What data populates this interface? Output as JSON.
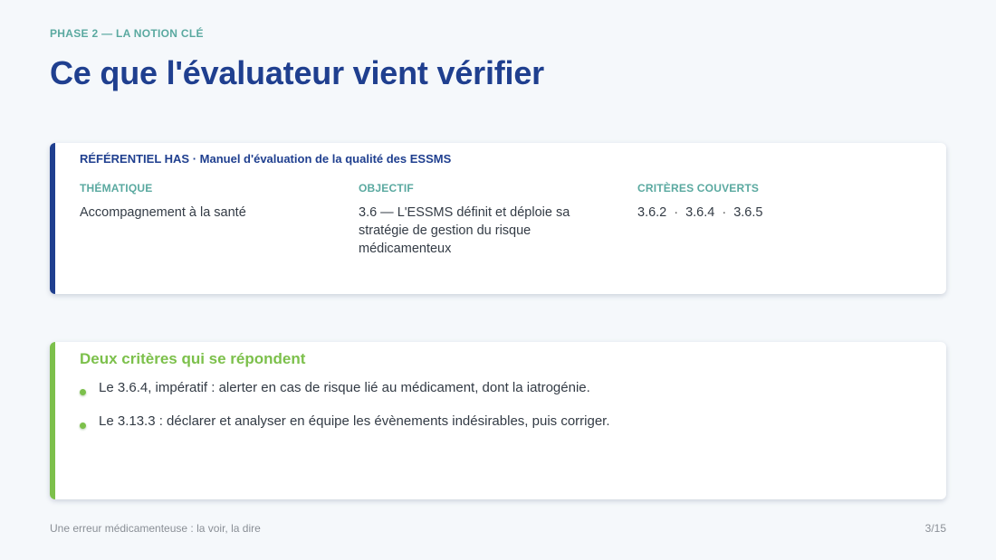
{
  "header": {
    "eyebrow": "PHASE 2 — LA NOTION CLÉ",
    "title": "Ce que l'évaluateur vient vérifier"
  },
  "referentiel": {
    "title": "RÉFÉRENTIEL HAS · Manuel d'évaluation de la qualité des ESSMS",
    "columns": [
      {
        "label": "THÉMATIQUE",
        "value": "Accompagnement à la santé"
      },
      {
        "label": "OBJECTIF",
        "value": "3.6 — L'ESSMS définit et déploie sa stratégie de gestion du risque médicamenteux"
      },
      {
        "label": "CRITÈRES COUVERTS",
        "items": [
          "3.6.2",
          "3.6.4",
          "3.6.5"
        ],
        "separator": "·"
      }
    ]
  },
  "criteres": {
    "title": "Deux critères qui se répondent",
    "bullets": [
      "Le 3.6.4, impératif : alerter en cas de risque lié au médicament, dont la iatrogénie.",
      "Le 3.13.3 : déclarer et analyser en équipe les évènements indésirables, puis corriger."
    ]
  },
  "footer": {
    "left": "Une erreur médicamenteuse : la voir, la dire",
    "page": "3/15"
  },
  "colors": {
    "primary": "#1f3f8f",
    "teal": "#5aa9a0",
    "green": "#7cc04b",
    "background": "#f5f8fb"
  }
}
